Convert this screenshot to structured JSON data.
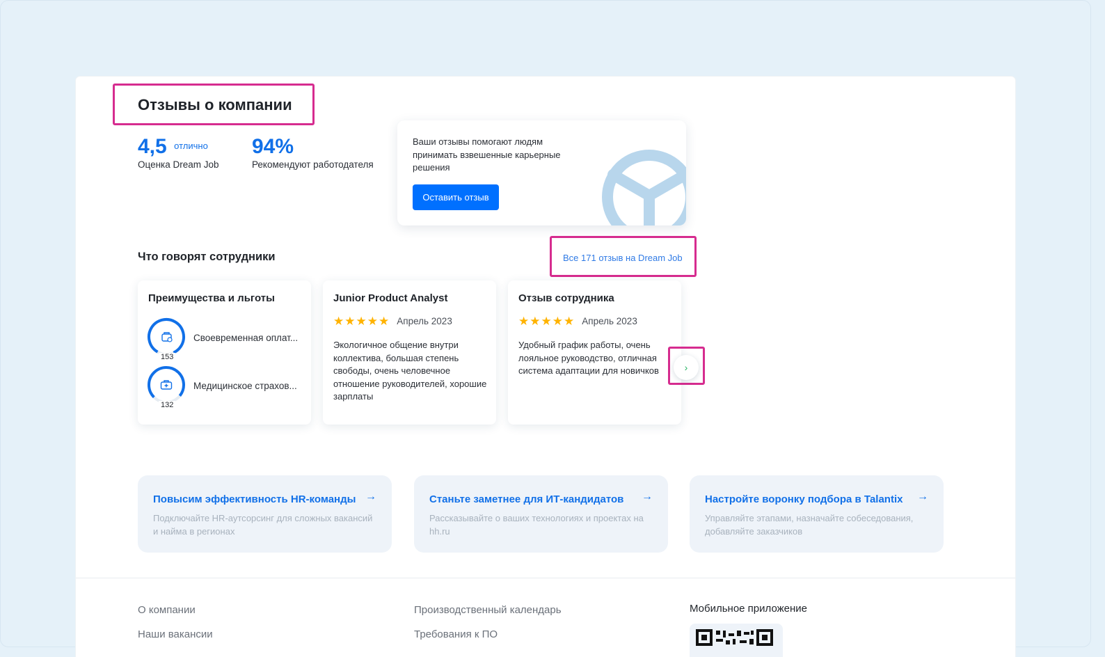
{
  "reviews": {
    "title": "Отзывы о компании",
    "rating_value": "4,5",
    "rating_word": "отлично",
    "rating_label": "Оценка Dream Job",
    "recommend_value": "94%",
    "recommend_label": "Рекомендуют работодателя"
  },
  "promo": {
    "text": "Ваши отзывы помогают людям принимать взвешенные карьерные решения",
    "button_label": "Оставить отзыв"
  },
  "employees": {
    "title": "Что говорят сотрудники",
    "all_link": "Все 171 отзыв на Dream Job"
  },
  "cards": [
    {
      "title": "Преимущества и льготы",
      "benefits": [
        {
          "label": "Своевременная оплат...",
          "count": "153",
          "icon": "wallet-icon"
        },
        {
          "label": "Медицинское страхов...",
          "count": "132",
          "icon": "medical-case-icon"
        }
      ]
    },
    {
      "title": "Junior Product Analyst",
      "rating": 5,
      "date": "Апрель 2023",
      "text": "Экологичное общение внутри коллектива, большая степень свободы, очень человечное отношение руководителей, хорошие зарплаты"
    },
    {
      "title": "Отзыв сотрудника",
      "rating": 5,
      "date": "Апрель 2023",
      "text": "Удобный график работы, очень лояльное руководство, отличная система адаптации для новичков"
    }
  ],
  "features": [
    {
      "title": "Повысим эффективность HR-команды",
      "desc": "Подключайте HR-аутсорсинг для сложных вакансий и найма в регионах"
    },
    {
      "title": "Станьте заметнее для ИТ-кандидатов",
      "desc": "Рассказывайте о ваших технологиях и проектах на hh.ru"
    },
    {
      "title": "Настройте воронку подбора в Talantix",
      "desc": "Управляйте этапами, назначайте собеседования, добавляйте заказчиков"
    }
  ],
  "footer": {
    "col1": [
      "О компании",
      "Наши вакансии"
    ],
    "col2": [
      "Производственный календарь",
      "Требования к ПО"
    ],
    "app_title": "Мобильное приложение"
  },
  "colors": {
    "accent": "#1170e8",
    "button": "#0070ff",
    "highlight": "#d62c8f",
    "star": "#ffb300"
  }
}
